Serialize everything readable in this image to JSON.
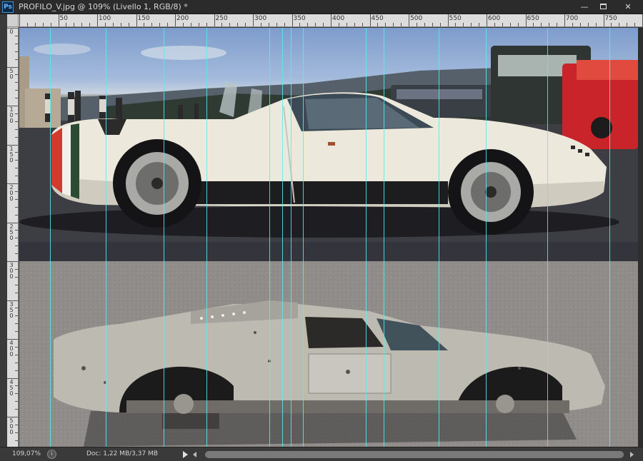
{
  "app": {
    "logo_text": "Ps",
    "window_title": "PROFILO_V.jpg @ 109% (Livello 1, RGB/8) *"
  },
  "window_buttons": {
    "minimize": "—",
    "close": "✕"
  },
  "ruler_top_labels": [
    "50",
    "100",
    "150",
    "200",
    "250",
    "300",
    "350",
    "400",
    "450",
    "500",
    "550",
    "600",
    "650",
    "700",
    "750"
  ],
  "ruler_left_labels": [
    "0",
    "50",
    "100",
    "150",
    "200",
    "250",
    "300",
    "350",
    "400",
    "450",
    "500"
  ],
  "status": {
    "zoom": "109,07%",
    "doc": "Doc: 1,22 MB/3,37 MB"
  },
  "colors": {
    "guide": "#4ff0f0",
    "car_white": "#ece9dc",
    "model_silver": "#bdbab2"
  },
  "icons": {
    "status_info": "circle-info-icon",
    "status_menu": "play-arrow-icon"
  }
}
